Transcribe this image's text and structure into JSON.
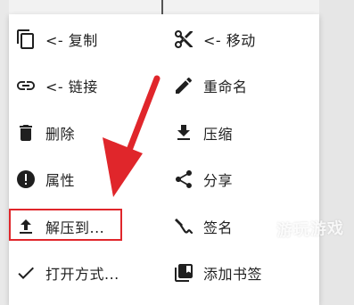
{
  "menu": {
    "left": [
      {
        "label": "<- 复制",
        "icon": "copy-icon"
      },
      {
        "label": "<- 链接",
        "icon": "link-icon"
      },
      {
        "label": "删除",
        "icon": "delete-icon"
      },
      {
        "label": "属性",
        "icon": "info-icon"
      },
      {
        "label": "解压到...",
        "icon": "upload-icon"
      },
      {
        "label": "打开方式...",
        "icon": "check-icon"
      }
    ],
    "right": [
      {
        "label": "<- 移动",
        "icon": "cut-icon"
      },
      {
        "label": "重命名",
        "icon": "pencil-icon"
      },
      {
        "label": "压缩",
        "icon": "download-icon"
      },
      {
        "label": "分享",
        "icon": "share-icon"
      },
      {
        "label": "签名",
        "icon": "signature-icon"
      },
      {
        "label": "添加书签",
        "icon": "bookmark-icon"
      }
    ]
  },
  "annotation": {
    "color": "#e0262b"
  },
  "watermark": {
    "text": "游玩游戏"
  }
}
